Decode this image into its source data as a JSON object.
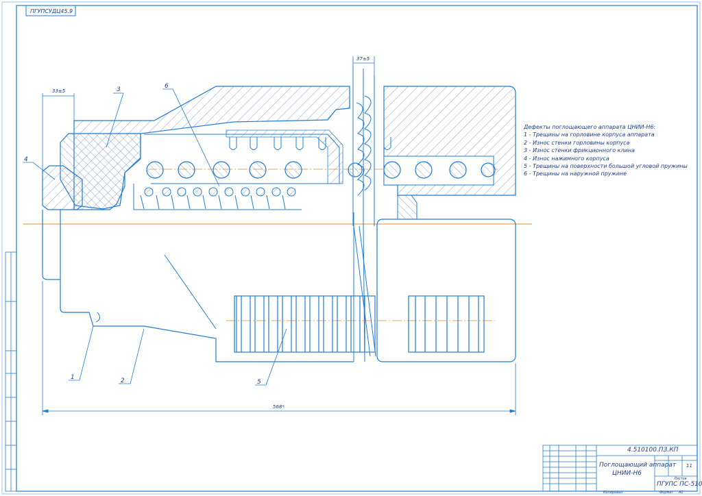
{
  "top_stamp": "ПГУПСУДЦ45.9",
  "dimensions": {
    "overall": "568*",
    "left": "33±5",
    "top": "37±5"
  },
  "callouts": [
    "1",
    "2",
    "3",
    "4",
    "5",
    "6"
  ],
  "legend": {
    "title": "Дефекты поглощающего аппарата ЦНИИ-Н6:",
    "items": [
      "1 - Трещины на горловине корпуса аппарата",
      "2 - Износ стенки горловины корпуса",
      "3 - Износ стенки фрикционного клина",
      "4 - Износ нажимного корпуса",
      "5 - Трещины на поверхности большой угловой пружины",
      "6 - Трещины на наружной пружине"
    ]
  },
  "title_block": {
    "doc_code": "4.510100.ПЗ.КП",
    "title_line1": "Поглощающий аппарат",
    "title_line2": "ЦНИИ-Н6",
    "organization": "ПГУПС ПС-510",
    "sheet_number": "11",
    "sheets_label": "Листов",
    "format_label": "Формат",
    "copied_label": "Копировал",
    "format_value": "А1"
  },
  "colors": {
    "line": "#1e7bd6",
    "text": "#1b3d8a",
    "axis": "#e08a2a",
    "hatch": "#4d6fa8"
  }
}
